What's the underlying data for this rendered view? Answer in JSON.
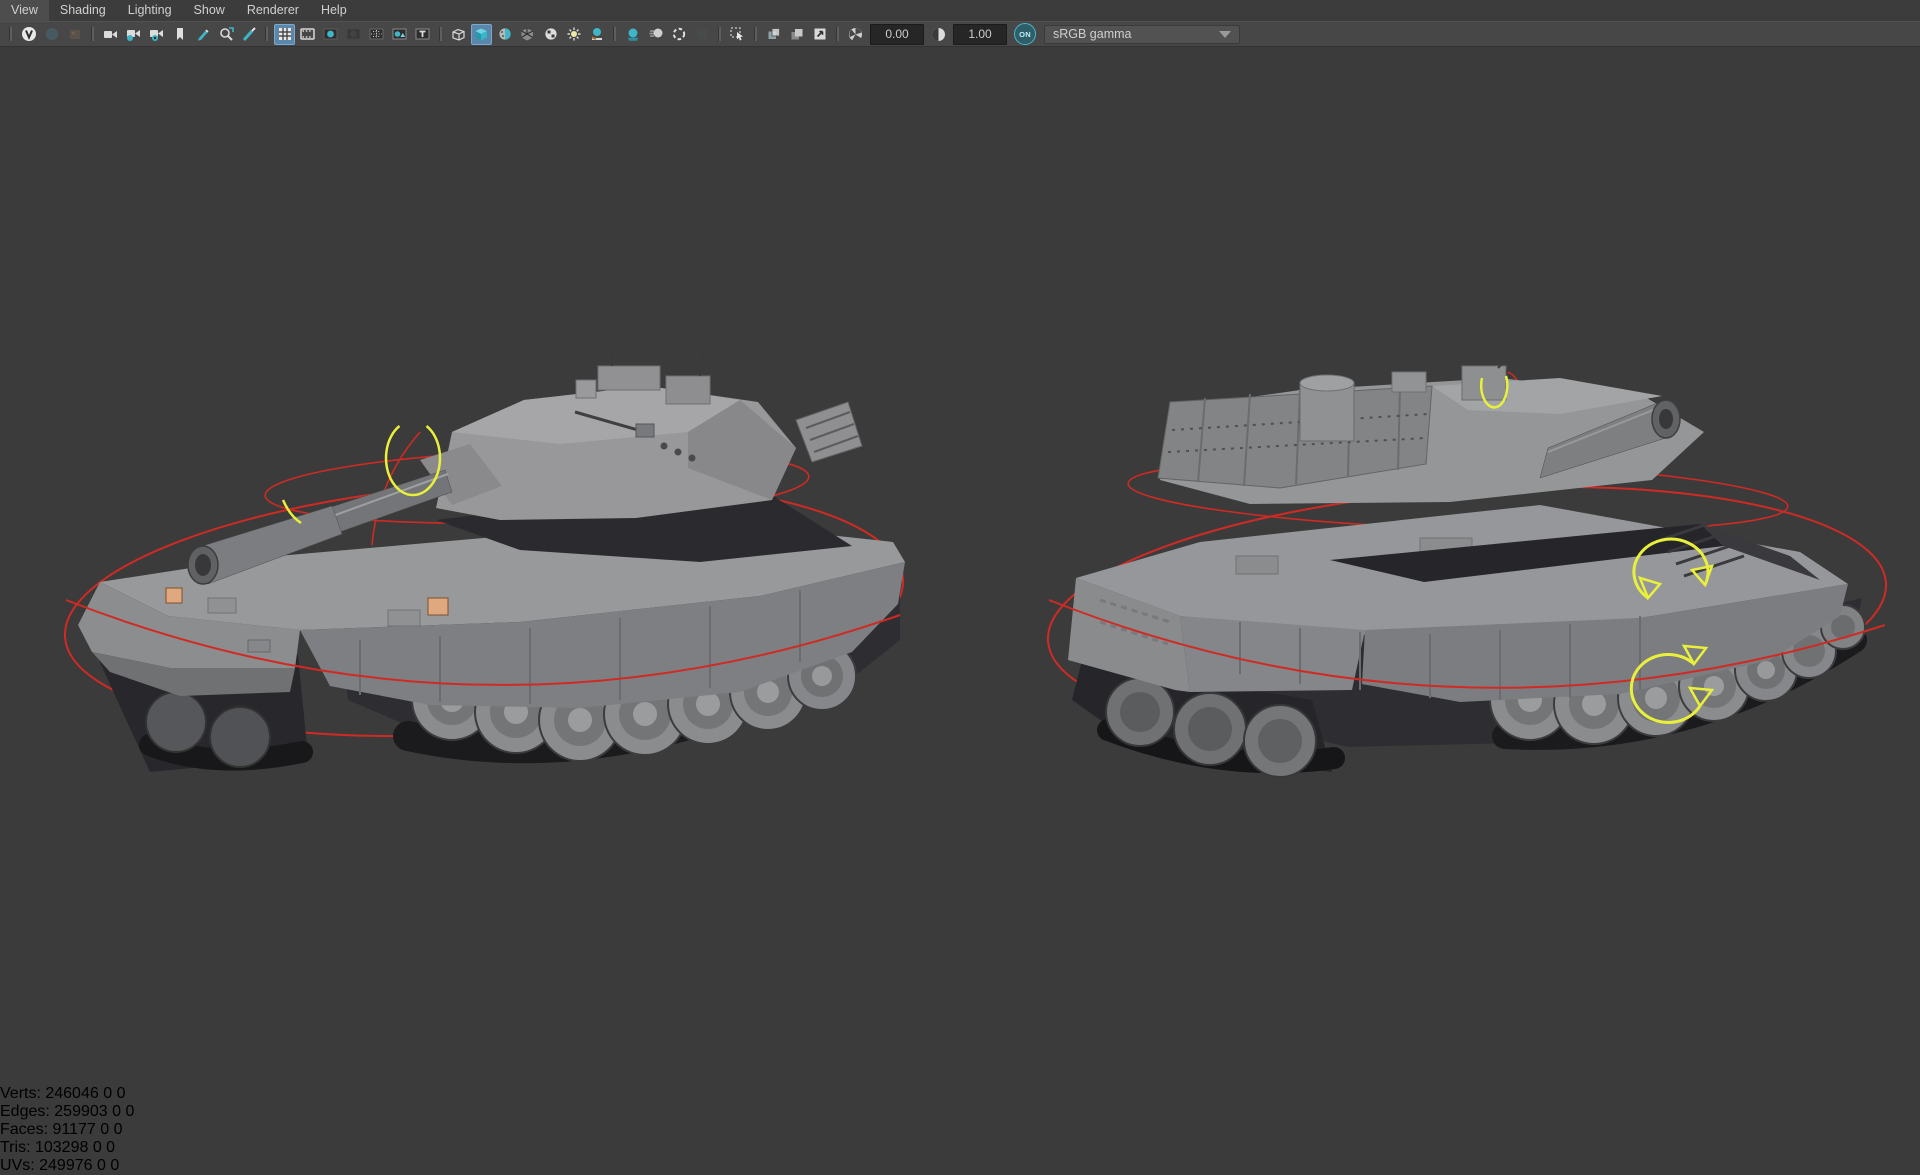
{
  "menu_bar": {
    "items": [
      "View",
      "Shading",
      "Lighting",
      "Show",
      "Renderer",
      "Help"
    ]
  },
  "toolbar": {
    "exposure_value": "0.00",
    "gamma_value": "1.00",
    "color_management_label": "ON",
    "view_transform": "sRGB gamma",
    "active_highlight_color": "#5b87ab",
    "teal_icon_color": "#3fb5c6",
    "icons": [
      "renderer-badge-icon",
      "pan-zoom-2d-dim-icon",
      "image-plane-dim-icon",
      "select-camera-icon",
      "lock-camera-icon",
      "camera-attributes-icon",
      "bookmark-view-icon",
      "grease-pencil-icon",
      "pan-zoom-tool-icon",
      "pick-tool-icon",
      "grid-icon",
      "film-gate-icon",
      "resolution-gate-icon",
      "gate-mask-icon",
      "field-chart-icon",
      "safe-action-icon",
      "safe-title-icon",
      "wireframe-cube-icon",
      "smooth-shade-icon",
      "default-material-icon",
      "wireframe-on-shaded-icon",
      "textured-icon",
      "use-all-lights-icon",
      "shadows-icon",
      "ssao-icon",
      "motion-blur-icon",
      "anti-aliasing-icon",
      "depth-of-field-icon",
      "isolate-select-icon",
      "xray-icon",
      "xray-active-icon",
      "plugin-shapes-icon",
      "exposure-icon",
      "contrast-icon",
      "color-management-toggle",
      "view-transform-dropdown"
    ],
    "active_icons": [
      "grid-icon",
      "smooth-shade-icon"
    ]
  },
  "hud": {
    "rows": [
      {
        "label": "Verts:",
        "total": "246046",
        "col2": "0",
        "col3": "0"
      },
      {
        "label": "Edges:",
        "total": "259903",
        "col2": "0",
        "col3": "0"
      },
      {
        "label": "Faces:",
        "total": "91177",
        "col2": "0",
        "col3": "0"
      },
      {
        "label": "Tris:",
        "total": "103298",
        "col2": "0",
        "col3": "0"
      },
      {
        "label": "UVs:",
        "total": "249976",
        "col2": "0",
        "col3": "0"
      }
    ]
  },
  "viewport": {
    "scene_description": "Two gray shaded tank 3D models with rotate manipulators",
    "gradient_top": "#94a1b1",
    "gradient_bottom": "#2b323c",
    "manipulator_ring_color": "#cf2b24",
    "manipulator_active_color": "#e9f03c",
    "model_highlight_color": "#dfa87e"
  }
}
